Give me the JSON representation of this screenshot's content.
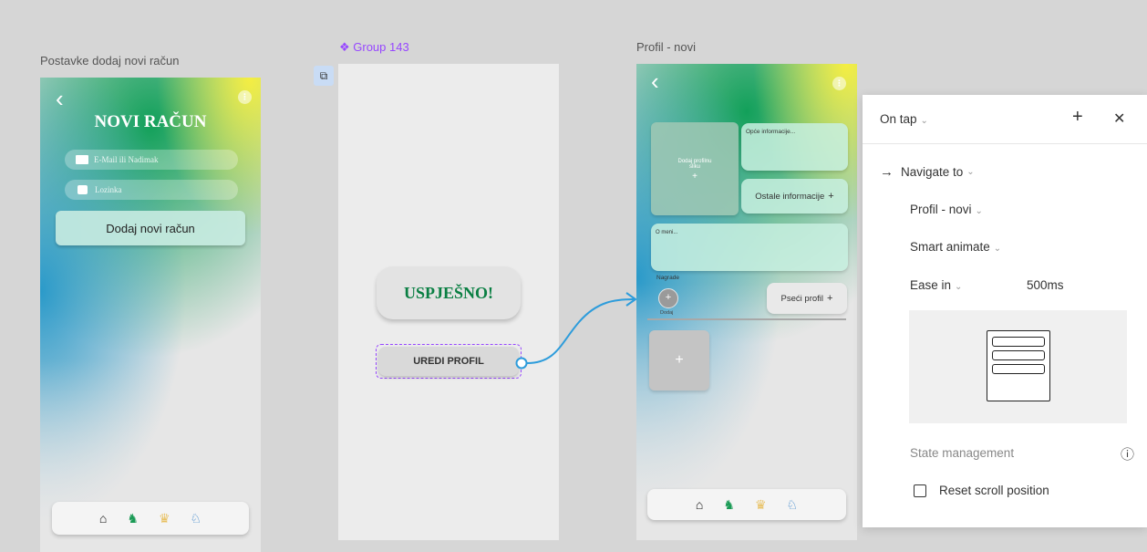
{
  "frames": {
    "left": {
      "label": "Postavke dodaj novi račun",
      "title": "NOVI RAČUN",
      "email_placeholder": "E-Mail ili Nadimak",
      "password_placeholder": "Lozinka",
      "button": "Dodaj novi račun"
    },
    "group": {
      "label": "❖ Group 143",
      "success": "USPJEŠNO!",
      "button": "UREDI PROFIL"
    },
    "profile": {
      "label": "Profil - novi",
      "add_photo": "Dodaj profilnu sliku",
      "add_photo_plus": "+",
      "general_info": "Opće informacije...",
      "other_info": "Ostale informacije",
      "other_info_plus": "+",
      "about": "O meni...",
      "awards": "Nagrade",
      "add_label": "Dodaj",
      "add_plus": "+",
      "dog_profile": "Pseći profil",
      "dog_profile_plus": "+",
      "tile_plus": "+"
    }
  },
  "icons": {
    "home": "home-icon",
    "walker": "dog-walker-icon",
    "crown": "crown-icon",
    "dog": "dog-icon",
    "back": "chevron-left-icon",
    "more": "more-options-icon"
  },
  "interaction_panel": {
    "trigger": "On tap",
    "add": "+",
    "close": "✕",
    "action_arrow": "→",
    "action": "Navigate to",
    "destination": "Profil - novi",
    "animation": "Smart animate",
    "easing": "Ease in",
    "duration": "500ms",
    "state_management": "State management",
    "info": "ⓘ",
    "reset_scroll": "Reset scroll position"
  },
  "colors": {
    "accent_purple": "#9747ff",
    "connector_blue": "#2d9cdb",
    "title_green": "#0a7f43"
  }
}
